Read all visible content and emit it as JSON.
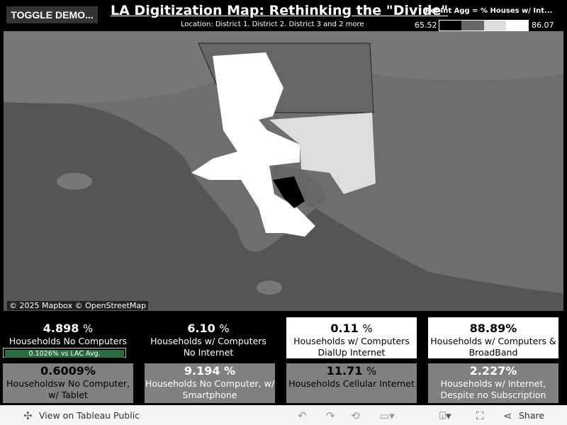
{
  "header": {
    "toggle_label": "TOGGLE DEMO...",
    "title": "LA Digitization Map: Rethinking the \"Divide\"",
    "subtitle": "Location: District 1, District 2, District 3 and 2 more"
  },
  "legend": {
    "title": "Pct Int Agg = % Houses w/ Int...",
    "min": "65.52",
    "max": "86.07",
    "colors": [
      "#000000",
      "#666666",
      "#dddddd",
      "#ffffff"
    ]
  },
  "map": {
    "attribution": "© 2025 Mapbox © OpenStreetMap"
  },
  "cards": [
    {
      "value": "4.898",
      "unit": "%",
      "label": "Households No Computers"
    },
    {
      "value": "6.10",
      "unit": "%",
      "label": "Households w/ Computers No Internet"
    },
    {
      "value": "0.11",
      "unit": "%",
      "label": "Households w/ Computers DialUp Internet"
    },
    {
      "value": "88.89%",
      "unit": "",
      "label": "Households w/ Computers & BroadBand"
    },
    {
      "value": "0.6009%",
      "unit": "",
      "label": "Householdsw No Computer, w/ Tablet"
    },
    {
      "value": "9.194 %",
      "unit": "",
      "label": "Households No Computer, w/ Smartphone"
    },
    {
      "value": "11.71",
      "unit": "%",
      "label": "Households Cellular Internet"
    },
    {
      "value": "2.227%",
      "unit": "",
      "label": "Households w/ Internet, Despite no Subscription"
    }
  ],
  "avg_bar": {
    "label": "0.1026% vs LAC Avg.",
    "color": "#2a6e3f"
  },
  "footer": {
    "view_label": "View on Tableau Public",
    "share_label": "Share"
  }
}
